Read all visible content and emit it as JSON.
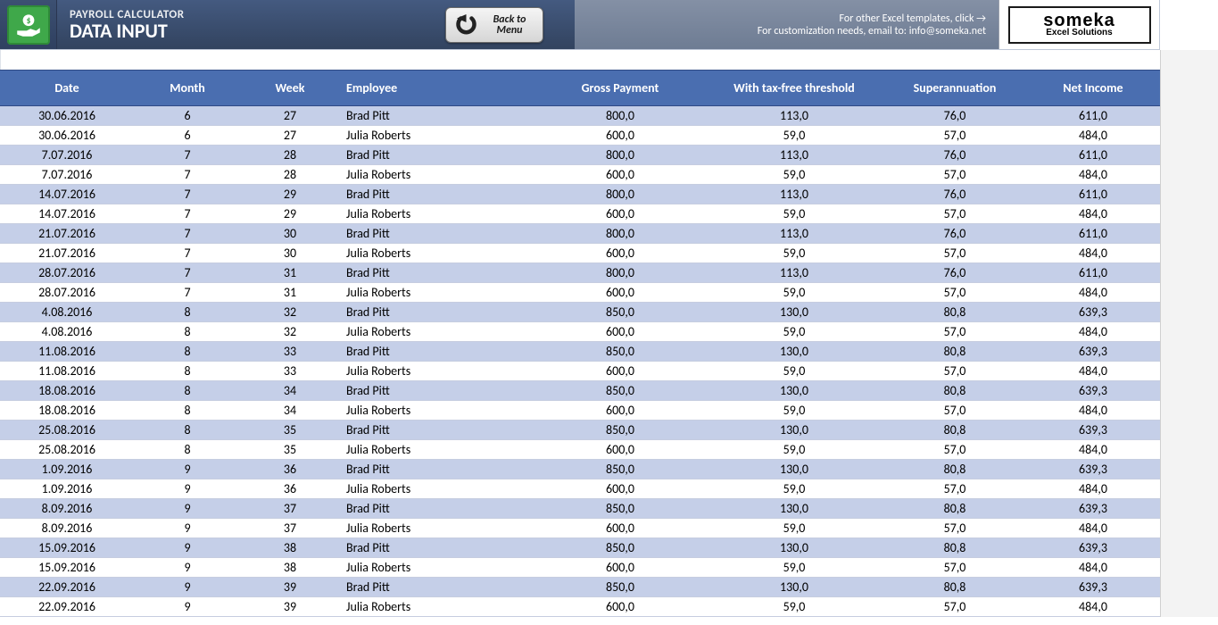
{
  "header": {
    "title_small": "PAYROLL CALCULATOR",
    "title_big": "DATA INPUT",
    "back_button": "Back to Menu",
    "msg_line1": "For other Excel templates, click →",
    "msg_line2": "For customization needs, email to: info@someka.net",
    "brand_name": "someka",
    "brand_tag": "Excel Solutions"
  },
  "columns": {
    "date": "Date",
    "month": "Month",
    "week": "Week",
    "employee": "Employee",
    "gross": "Gross Payment",
    "tax": "With tax-free threshold",
    "super": "Superannuation",
    "net": "Net Income"
  },
  "rows": [
    {
      "date": "30.06.2016",
      "month": "6",
      "week": "27",
      "employee": "Brad Pitt",
      "gross": "800,0",
      "tax": "113,0",
      "super": "76,0",
      "net": "611,0"
    },
    {
      "date": "30.06.2016",
      "month": "6",
      "week": "27",
      "employee": "Julia Roberts",
      "gross": "600,0",
      "tax": "59,0",
      "super": "57,0",
      "net": "484,0"
    },
    {
      "date": "7.07.2016",
      "month": "7",
      "week": "28",
      "employee": "Brad Pitt",
      "gross": "800,0",
      "tax": "113,0",
      "super": "76,0",
      "net": "611,0"
    },
    {
      "date": "7.07.2016",
      "month": "7",
      "week": "28",
      "employee": "Julia Roberts",
      "gross": "600,0",
      "tax": "59,0",
      "super": "57,0",
      "net": "484,0"
    },
    {
      "date": "14.07.2016",
      "month": "7",
      "week": "29",
      "employee": "Brad Pitt",
      "gross": "800,0",
      "tax": "113,0",
      "super": "76,0",
      "net": "611,0"
    },
    {
      "date": "14.07.2016",
      "month": "7",
      "week": "29",
      "employee": "Julia Roberts",
      "gross": "600,0",
      "tax": "59,0",
      "super": "57,0",
      "net": "484,0"
    },
    {
      "date": "21.07.2016",
      "month": "7",
      "week": "30",
      "employee": "Brad Pitt",
      "gross": "800,0",
      "tax": "113,0",
      "super": "76,0",
      "net": "611,0"
    },
    {
      "date": "21.07.2016",
      "month": "7",
      "week": "30",
      "employee": "Julia Roberts",
      "gross": "600,0",
      "tax": "59,0",
      "super": "57,0",
      "net": "484,0"
    },
    {
      "date": "28.07.2016",
      "month": "7",
      "week": "31",
      "employee": "Brad Pitt",
      "gross": "800,0",
      "tax": "113,0",
      "super": "76,0",
      "net": "611,0"
    },
    {
      "date": "28.07.2016",
      "month": "7",
      "week": "31",
      "employee": "Julia Roberts",
      "gross": "600,0",
      "tax": "59,0",
      "super": "57,0",
      "net": "484,0"
    },
    {
      "date": "4.08.2016",
      "month": "8",
      "week": "32",
      "employee": "Brad Pitt",
      "gross": "850,0",
      "tax": "130,0",
      "super": "80,8",
      "net": "639,3"
    },
    {
      "date": "4.08.2016",
      "month": "8",
      "week": "32",
      "employee": "Julia Roberts",
      "gross": "600,0",
      "tax": "59,0",
      "super": "57,0",
      "net": "484,0"
    },
    {
      "date": "11.08.2016",
      "month": "8",
      "week": "33",
      "employee": "Brad Pitt",
      "gross": "850,0",
      "tax": "130,0",
      "super": "80,8",
      "net": "639,3"
    },
    {
      "date": "11.08.2016",
      "month": "8",
      "week": "33",
      "employee": "Julia Roberts",
      "gross": "600,0",
      "tax": "59,0",
      "super": "57,0",
      "net": "484,0"
    },
    {
      "date": "18.08.2016",
      "month": "8",
      "week": "34",
      "employee": "Brad Pitt",
      "gross": "850,0",
      "tax": "130,0",
      "super": "80,8",
      "net": "639,3"
    },
    {
      "date": "18.08.2016",
      "month": "8",
      "week": "34",
      "employee": "Julia Roberts",
      "gross": "600,0",
      "tax": "59,0",
      "super": "57,0",
      "net": "484,0"
    },
    {
      "date": "25.08.2016",
      "month": "8",
      "week": "35",
      "employee": "Brad Pitt",
      "gross": "850,0",
      "tax": "130,0",
      "super": "80,8",
      "net": "639,3"
    },
    {
      "date": "25.08.2016",
      "month": "8",
      "week": "35",
      "employee": "Julia Roberts",
      "gross": "600,0",
      "tax": "59,0",
      "super": "57,0",
      "net": "484,0"
    },
    {
      "date": "1.09.2016",
      "month": "9",
      "week": "36",
      "employee": "Brad Pitt",
      "gross": "850,0",
      "tax": "130,0",
      "super": "80,8",
      "net": "639,3"
    },
    {
      "date": "1.09.2016",
      "month": "9",
      "week": "36",
      "employee": "Julia Roberts",
      "gross": "600,0",
      "tax": "59,0",
      "super": "57,0",
      "net": "484,0"
    },
    {
      "date": "8.09.2016",
      "month": "9",
      "week": "37",
      "employee": "Brad Pitt",
      "gross": "850,0",
      "tax": "130,0",
      "super": "80,8",
      "net": "639,3"
    },
    {
      "date": "8.09.2016",
      "month": "9",
      "week": "37",
      "employee": "Julia Roberts",
      "gross": "600,0",
      "tax": "59,0",
      "super": "57,0",
      "net": "484,0"
    },
    {
      "date": "15.09.2016",
      "month": "9",
      "week": "38",
      "employee": "Brad Pitt",
      "gross": "850,0",
      "tax": "130,0",
      "super": "80,8",
      "net": "639,3"
    },
    {
      "date": "15.09.2016",
      "month": "9",
      "week": "38",
      "employee": "Julia Roberts",
      "gross": "600,0",
      "tax": "59,0",
      "super": "57,0",
      "net": "484,0"
    },
    {
      "date": "22.09.2016",
      "month": "9",
      "week": "39",
      "employee": "Brad Pitt",
      "gross": "850,0",
      "tax": "130,0",
      "super": "80,8",
      "net": "639,3"
    },
    {
      "date": "22.09.2016",
      "month": "9",
      "week": "39",
      "employee": "Julia Roberts",
      "gross": "600,0",
      "tax": "59,0",
      "super": "57,0",
      "net": "484,0"
    }
  ]
}
